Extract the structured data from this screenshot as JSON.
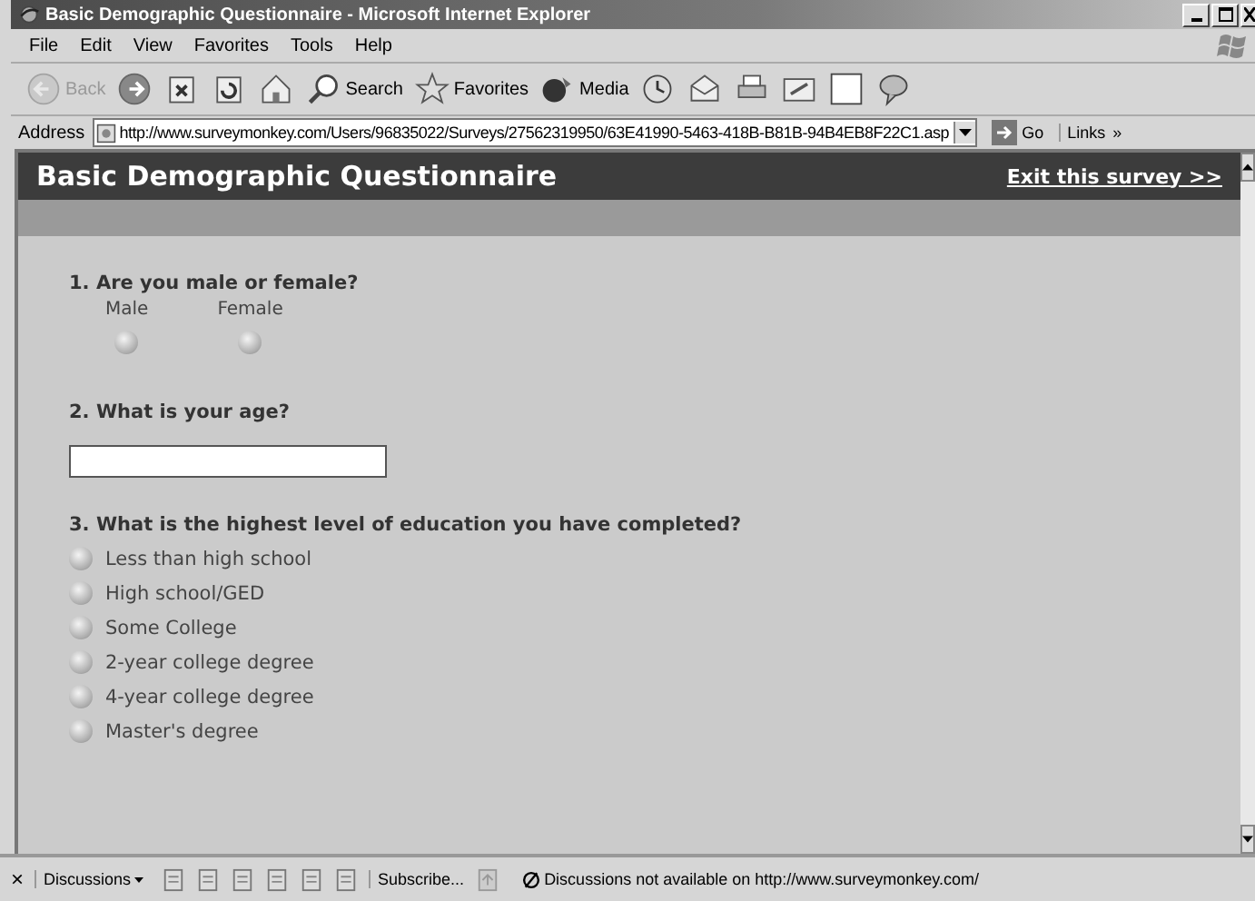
{
  "window": {
    "title": "Basic Demographic Questionnaire - Microsoft Internet Explorer"
  },
  "menu": [
    "File",
    "Edit",
    "View",
    "Favorites",
    "Tools",
    "Help"
  ],
  "toolbar": [
    {
      "kind": "back",
      "label": "Back",
      "disabled": true
    },
    {
      "kind": "forward",
      "disabled": false
    },
    {
      "kind": "stop",
      "disabled": false
    },
    {
      "kind": "refresh",
      "disabled": false
    },
    {
      "kind": "home",
      "disabled": false
    },
    {
      "kind": "search",
      "label": "Search",
      "disabled": false
    },
    {
      "kind": "favorites",
      "label": "Favorites",
      "disabled": false
    },
    {
      "kind": "media",
      "label": "Media",
      "disabled": false
    },
    {
      "kind": "history",
      "disabled": false
    },
    {
      "kind": "mail",
      "disabled": false
    },
    {
      "kind": "print",
      "disabled": false
    },
    {
      "kind": "edit",
      "disabled": false
    },
    {
      "kind": "discuss",
      "disabled": false
    },
    {
      "kind": "messenger",
      "disabled": false
    }
  ],
  "address": {
    "label": "Address",
    "value": "http://www.surveymonkey.com/Users/96835022/Surveys/27562319950/63E41990-5463-418B-B81B-94B4EB8F22C1.asp",
    "go": "Go",
    "links": "Links",
    "more": "»"
  },
  "survey": {
    "title": "Basic Demographic Questionnaire",
    "exit_link": "Exit this survey >>",
    "questions": [
      {
        "kind": "horizontal",
        "text": "1. Are you male or female?",
        "options": [
          {
            "label": "Male",
            "selected": false
          },
          {
            "label": "Female",
            "selected": false
          }
        ]
      },
      {
        "kind": "text",
        "text": "2. What is your age?"
      },
      {
        "kind": "vertical",
        "text": "3. What is the highest level of education you have completed?",
        "options": [
          {
            "label": "Less than high school",
            "selected": false
          },
          {
            "label": "High school/GED",
            "selected": false
          },
          {
            "label": "Some College",
            "selected": false
          },
          {
            "label": "2-year college degree",
            "selected": false
          },
          {
            "label": "4-year college degree",
            "selected": false
          },
          {
            "label": "Master's degree",
            "selected": false
          }
        ]
      }
    ]
  },
  "discussions_bar": {
    "close": "×",
    "menu": "Discussions",
    "subscribe": "Subscribe...",
    "status": "Discussions not available on http://www.surveymonkey.com/"
  }
}
